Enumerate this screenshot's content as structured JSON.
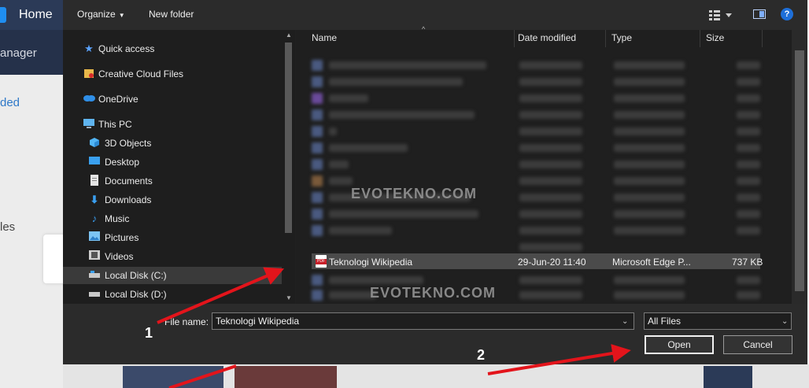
{
  "background_app": {
    "home_label": "Home",
    "manager_fragment": "anager",
    "loaded_fragment": "ded",
    "files_fragment": "les"
  },
  "toolbar": {
    "organize_label": "Organize",
    "new_folder_label": "New folder",
    "help_glyph": "?"
  },
  "nav": {
    "items": [
      {
        "label": "Quick access",
        "icon": "star-icon"
      },
      {
        "label": "Creative Cloud Files",
        "icon": "creative-cloud-icon"
      },
      {
        "label": "OneDrive",
        "icon": "cloud-icon"
      },
      {
        "label": "This PC",
        "icon": "computer-icon"
      },
      {
        "label": "3D Objects",
        "icon": "cube-icon"
      },
      {
        "label": "Desktop",
        "icon": "desktop-icon"
      },
      {
        "label": "Documents",
        "icon": "document-icon"
      },
      {
        "label": "Downloads",
        "icon": "download-icon"
      },
      {
        "label": "Music",
        "icon": "music-icon"
      },
      {
        "label": "Pictures",
        "icon": "picture-icon"
      },
      {
        "label": "Videos",
        "icon": "video-icon"
      },
      {
        "label": "Local Disk (C:)",
        "icon": "drive-icon"
      },
      {
        "label": "Local Disk (D:)",
        "icon": "drive-icon"
      }
    ]
  },
  "file_list": {
    "columns": [
      "Name",
      "Date modified",
      "Type",
      "Size"
    ],
    "selected_file": {
      "name": "Teknologi Wikipedia",
      "date_modified": "29-Jun-20 11:40",
      "type": "Microsoft Edge P...",
      "size": "737 KB"
    }
  },
  "watermark": "EVOTEKNO.COM",
  "footer": {
    "file_name_label": "File name:",
    "file_name_value": "Teknologi Wikipedia",
    "file_type_value": "All Files",
    "open_label": "Open",
    "cancel_label": "Cancel"
  },
  "annotations": {
    "step1": "1",
    "step2": "2"
  },
  "colors": {
    "dialog_bg": "#202020",
    "accent_blue": "#1e6fd9",
    "arrow_red": "#e3141b"
  }
}
